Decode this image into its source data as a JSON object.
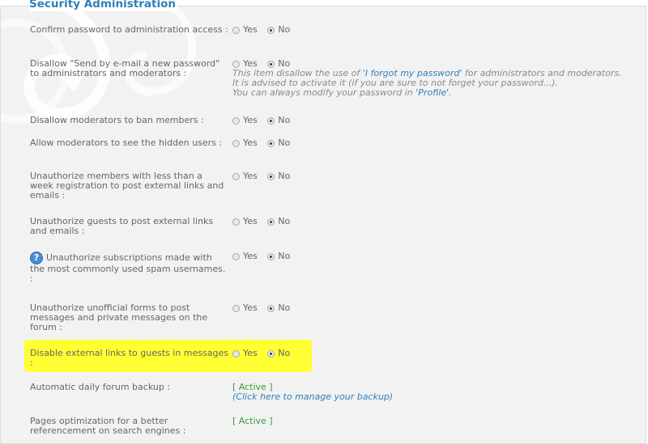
{
  "section_title": "Security Administration",
  "yes_label": "Yes",
  "no_label": "No",
  "rows": [
    {
      "label": "Confirm password to administration access :",
      "selected": "No"
    },
    {
      "label": "Disallow \"Send by e-mail a new password\" to administrators and moderators :",
      "selected": "No",
      "desc": {
        "line1_pre": "This item disallow the use of ",
        "line1_link": "'I forgot my password'",
        "line1_post": " for administrators and moderators.",
        "line2": "It is advised to activate it (if you are sure to not forget your password...).",
        "line3_pre": "You can always modify your password in ",
        "line3_link": "'Profile'",
        "line3_post": "."
      }
    },
    {
      "label": "Disallow moderators to ban members :",
      "selected": "No"
    },
    {
      "label": "Allow moderators to see the hidden users :",
      "selected": "No"
    },
    {
      "label": "Unauthorize members with less than a week registration to post external links and emails :",
      "selected": "No"
    },
    {
      "label": "Unauthorize guests to post external links and emails :",
      "selected": "No"
    },
    {
      "label": "Unauthorize subscriptions made with the most commonly used spam usernames. :",
      "selected": "No",
      "help_icon": "question-icon"
    },
    {
      "label": "Unauthorize unofficial forms to post messages and private messages on the forum :",
      "selected": "No"
    },
    {
      "label": "Disable external links to guests in messages :",
      "selected": "No",
      "highlighted": true
    }
  ],
  "backup": {
    "label": "Automatic daily forum backup :",
    "status": "[ Active ]",
    "manage_link": "(Click here to manage your backup)"
  },
  "seo": {
    "label": "Pages optimization for a better referencement on search engines :",
    "status": "[ Active ]"
  },
  "colors": {
    "title": "#2f7fb6",
    "highlight": "#ffff33",
    "active": "#3c9a3c"
  }
}
